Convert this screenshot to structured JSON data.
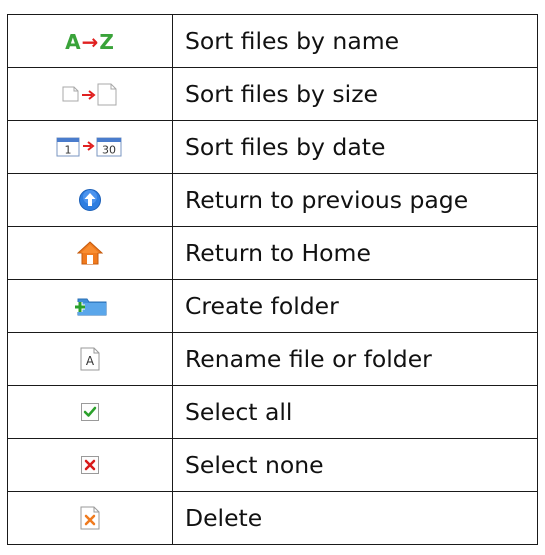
{
  "colors": {
    "border": "#1a1a1a",
    "text": "#111111",
    "arrow_red": "#e02020",
    "az_green": "#3aa33a",
    "blue_circle": "#2d7de0",
    "home_orange": "#f07a1e",
    "folder_blue": "#3f8fd8",
    "check_green": "#2aa02a",
    "x_red": "#d81a1a"
  },
  "rows": [
    {
      "icon": "sort-by-name-icon",
      "icon_text": {
        "left": "A",
        "right": "Z"
      },
      "label": "Sort files by name"
    },
    {
      "icon": "sort-by-size-icon",
      "label": "Sort files by size"
    },
    {
      "icon": "sort-by-date-icon",
      "icon_text": {
        "left": "1",
        "right": "30"
      },
      "label": "Sort files by date"
    },
    {
      "icon": "arrow-up-circle-icon",
      "label": "Return to previous page"
    },
    {
      "icon": "home-icon",
      "label": "Return to Home"
    },
    {
      "icon": "new-folder-icon",
      "label": "Create folder"
    },
    {
      "icon": "rename-icon",
      "icon_text": {
        "letter": "A"
      },
      "label": "Rename file or folder"
    },
    {
      "icon": "checkbox-checked-icon",
      "label": "Select all"
    },
    {
      "icon": "checkbox-x-icon",
      "label": "Select none"
    },
    {
      "icon": "delete-icon",
      "label": "Delete"
    }
  ]
}
